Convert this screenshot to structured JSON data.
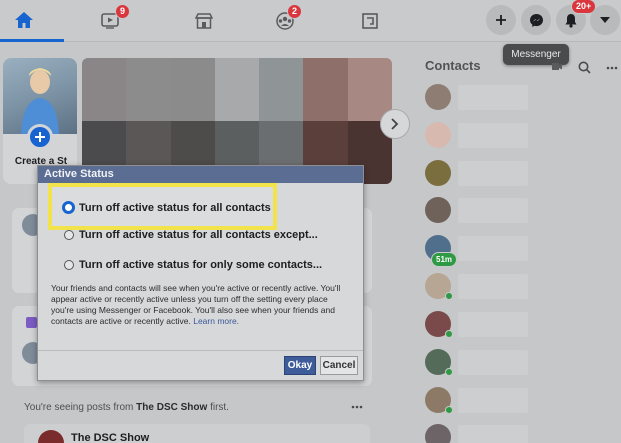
{
  "nav": {
    "tabs": [
      {
        "name": "home",
        "icon": "home-icon"
      },
      {
        "name": "watch",
        "icon": "video-icon",
        "badge": "9"
      },
      {
        "name": "marketplace",
        "icon": "store-icon"
      },
      {
        "name": "groups",
        "icon": "groups-icon",
        "badge": "2"
      },
      {
        "name": "gaming",
        "icon": "gaming-icon"
      }
    ],
    "notifications_badge": "20+",
    "tooltip": "Messenger"
  },
  "stories": {
    "create_label": "Create a St"
  },
  "contacts": {
    "title": "Contacts",
    "items": [
      {
        "label": ""
      },
      {
        "label": ""
      },
      {
        "label": ""
      },
      {
        "label": ""
      },
      {
        "label": "51m"
      },
      {
        "label": ""
      },
      {
        "label": ""
      },
      {
        "label": ""
      },
      {
        "label": ""
      },
      {
        "label": ""
      },
      {
        "label": ""
      }
    ]
  },
  "dialog": {
    "title": "Active Status",
    "options": [
      "Turn off active status for all contacts",
      "Turn off active status for all contacts except...",
      "Turn off active status for only some contacts..."
    ],
    "selected_option": 0,
    "description": "Your friends and contacts will see when you're active or recently active. You'll appear active or recently active unless you turn off the setting every place you're using Messenger or Facebook. You'll also see when your friends and contacts are active or recently active.",
    "learn_more": "Learn more.",
    "okay_label": "Okay",
    "cancel_label": "Cancel"
  },
  "feed": {
    "seeing_prefix": "You're seeing posts from ",
    "seeing_page": "The DSC Show",
    "seeing_suffix": " first.",
    "post_name": "The DSC Show"
  },
  "colors": {
    "accent": "#1763cf",
    "dialog_title_bar": "#5b6d92",
    "highlight": "#f3e34a",
    "badge": "#d9363e",
    "online": "#2e9a43"
  }
}
